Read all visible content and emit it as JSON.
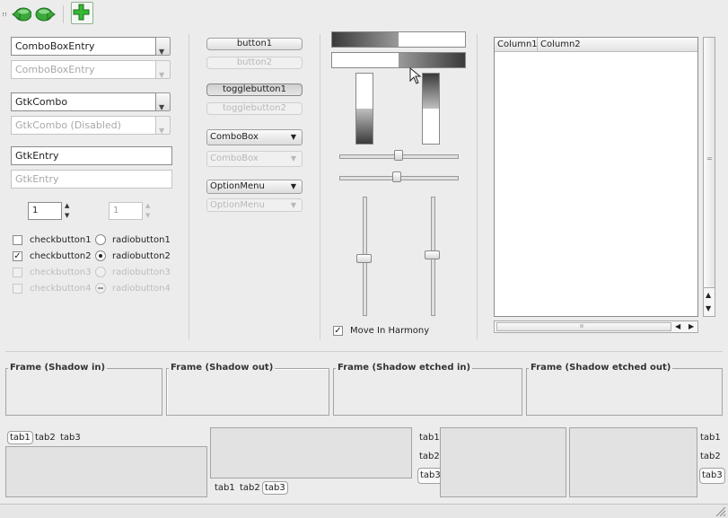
{
  "toolbar": {
    "items": [
      {
        "icon": "back-arrow-icon"
      },
      {
        "icon": "forward-arrow-icon"
      },
      {
        "icon": "add-icon"
      }
    ],
    "accent": "#2e9a2e"
  },
  "col1": {
    "combo_entry": "ComboBoxEntry",
    "combo_entry_disabled": "ComboBoxEntry",
    "gtk_combo": "GtkCombo",
    "gtk_combo_disabled": "GtkCombo (Disabled)",
    "entry": "GtkEntry",
    "entry_disabled": "GtkEntry",
    "spin1": "1",
    "spin2": "1",
    "checks": [
      "checkbutton1",
      "checkbutton2",
      "checkbutton3",
      "checkbutton4"
    ],
    "radios": [
      "radiobutton1",
      "radiobutton2",
      "radiobutton3",
      "radiobutton4"
    ],
    "checked": [
      false,
      true,
      false,
      false
    ]
  },
  "col2": {
    "button1": "button1",
    "button2": "button2",
    "toggle1": "togglebutton1",
    "toggle2": "togglebutton2",
    "combobox": "ComboBox",
    "combobox_disabled": "ComboBox",
    "optionmenu": "OptionMenu",
    "optionmenu_disabled": "OptionMenu"
  },
  "col3": {
    "progress_h1": 0.5,
    "progress_h2": 0.5,
    "progress_v1": 0.5,
    "progress_v2": 0.5,
    "hscale1": 0.5,
    "hscale2": 0.5,
    "vscale1": 0.5,
    "vscale2": 0.5,
    "harmony_label": "Move In Harmony",
    "harmony_checked": true
  },
  "tree": {
    "columns": [
      "Column1",
      "Column2"
    ],
    "hscroll_grip": "ıı",
    "vscroll_grip": "="
  },
  "frames": [
    "Frame (Shadow in)",
    "Frame (Shadow out)",
    "Frame (Shadow etched in)",
    "Frame (Shadow etched out)"
  ],
  "notebooks": {
    "tabs": [
      "tab1",
      "tab2",
      "tab3"
    ]
  }
}
